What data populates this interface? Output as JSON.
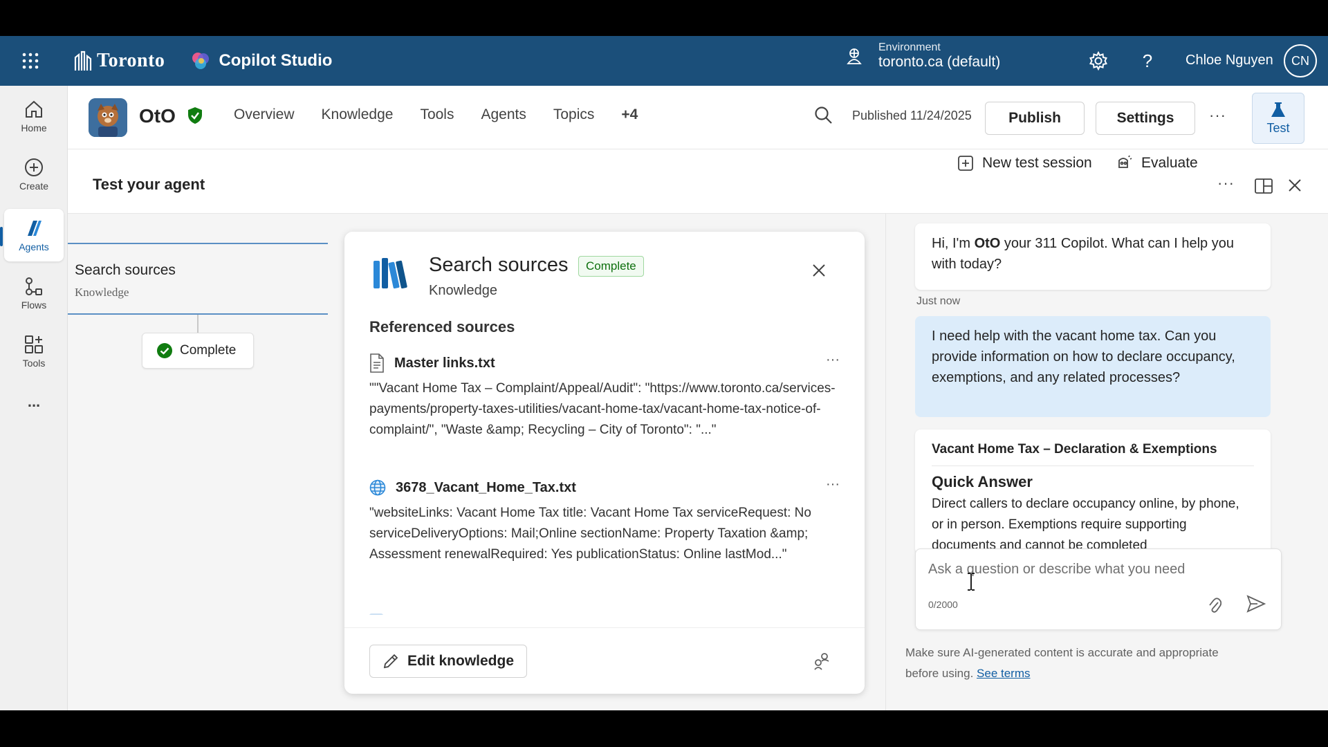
{
  "topbar": {
    "brand_city": "Toronto",
    "product": "Copilot Studio",
    "environment_label": "Environment",
    "environment_value": "toronto.ca (default)",
    "user_name": "Chloe Nguyen",
    "user_initials": "CN"
  },
  "rail": {
    "items": [
      {
        "label": "Home",
        "icon": "home-icon"
      },
      {
        "label": "Create",
        "icon": "plus-circle-icon"
      },
      {
        "label": "Agents",
        "icon": "agents-icon"
      },
      {
        "label": "Flows",
        "icon": "flows-icon"
      },
      {
        "label": "Tools",
        "icon": "tools-icon"
      }
    ],
    "more": "..."
  },
  "agent": {
    "name": "OtO",
    "nav": [
      "Overview",
      "Knowledge",
      "Tools",
      "Agents",
      "Topics",
      "+4"
    ],
    "published": "Published 11/24/2025",
    "publish_label": "Publish",
    "settings_label": "Settings",
    "more": "···",
    "test_label": "Test"
  },
  "test": {
    "title": "Test your agent",
    "new_session": "New test session",
    "evaluate": "Evaluate",
    "more": "···"
  },
  "canvas": {
    "node_title": "Search sources",
    "node_sub": "Knowledge",
    "status": "Complete"
  },
  "detail": {
    "title": "Search sources",
    "badge": "Complete",
    "subtitle": "Knowledge",
    "ref_heading": "Referenced sources",
    "sources": [
      {
        "name": "Master links.txt",
        "icon": "document-icon",
        "body": "\"\"Vacant Home Tax – Complaint/Appeal/Audit\": \"https://www.toronto.ca/services-payments/property-taxes-utilities/vacant-home-tax/vacant-home-tax-notice-of-complaint/\", \"Waste &amp; Recycling – City of Toronto\": \"...\""
      },
      {
        "name": "3678_Vacant_Home_Tax.txt",
        "icon": "globe-icon",
        "body": "\"websiteLinks: Vacant Home Tax title: Vacant Home Tax serviceRequest: No serviceDeliveryOptions: Mail;Online sectionName: Property Taxation &amp; Assessment renewalRequired: Yes publicationStatus: Online lastMod...\""
      }
    ],
    "more": "···",
    "edit_label": "Edit knowledge"
  },
  "chat": {
    "greeting_pre": "Hi, I'm ",
    "greeting_name": "OtO",
    "greeting_post": " your 311 Copilot. What can I help you with today?",
    "timestamp": "Just now",
    "user_message": "I need help with the vacant home tax. Can you provide information on how to declare occupancy, exemptions, and any related processes?",
    "answer_title": "Vacant Home Tax – Declaration & Exemptions",
    "answer_heading": "Quick Answer",
    "answer_body": "Direct callers to declare occupancy online, by phone, or in person. Exemptions require supporting documents and cannot be completed",
    "input_placeholder": "Ask a question or describe what you need",
    "counter": "0/2000",
    "disclaimer": "Make sure AI-generated content is accurate and appropriate before using.",
    "terms_link": "See terms"
  },
  "colors": {
    "topbar": "#1b4f7a",
    "accent": "#115ea3",
    "success": "#107c10",
    "user_bubble": "#dcecfa"
  }
}
